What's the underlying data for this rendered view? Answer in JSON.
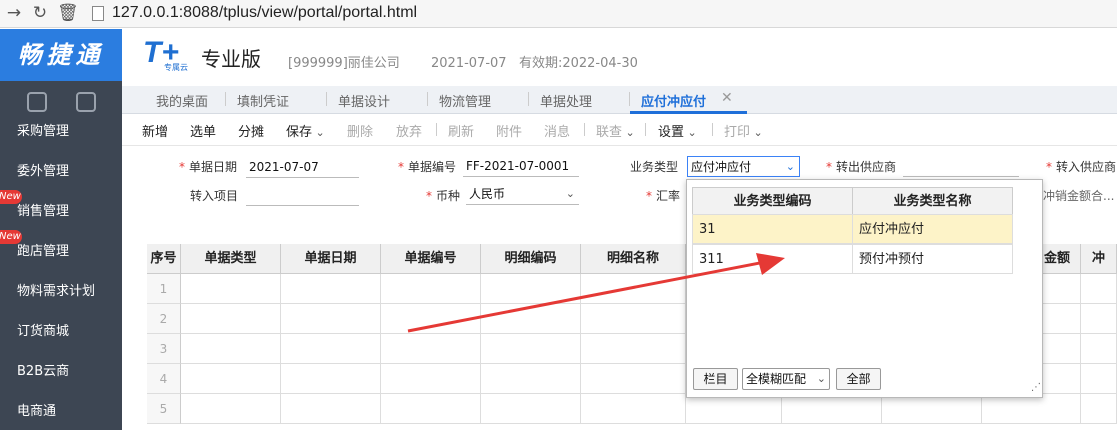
{
  "browser": {
    "url": "127.0.0.1:8088/tplus/view/portal/portal.html"
  },
  "sidebar": {
    "brand": "畅捷通",
    "items": [
      {
        "label": "采购管理"
      },
      {
        "label": "委外管理"
      },
      {
        "label": "销售管理",
        "badge": "New"
      },
      {
        "label": "跑店管理",
        "badge": "New"
      },
      {
        "label": "物料需求计划"
      },
      {
        "label": "订货商城"
      },
      {
        "label": "B2B云商"
      },
      {
        "label": "电商通"
      }
    ]
  },
  "header": {
    "logo": "T+",
    "logo_sub": "专属云",
    "edition": "专业版",
    "company": "[999999]丽佳公司",
    "date_info": "2021-07-07   有效期:2022-04-30"
  },
  "tabs": [
    "我的桌面",
    "填制凭证",
    "单据设计",
    "物流管理",
    "单据处理",
    "应付冲应付"
  ],
  "toolbar": {
    "items": [
      "新增",
      "选单",
      "分摊",
      "保存",
      "删除",
      "放弃",
      "刷新",
      "附件",
      "消息",
      "联查",
      "设置",
      "打印"
    ]
  },
  "form": {
    "doc_date_label": "单据日期",
    "doc_date": "2021-07-07",
    "doc_no_label": "单据编号",
    "doc_no": "FF-2021-07-0001",
    "biz_type_label": "业务类型",
    "biz_type": "应付冲应付",
    "out_supplier_label": "转出供应商",
    "in_supplier_label": "转入供应商",
    "in_project_label": "转入项目",
    "currency_label": "币种",
    "currency": "人民币",
    "rate_label": "汇率",
    "offset_amount_label": "冲销金额合..."
  },
  "grid": {
    "columns": [
      "序号",
      "单据类型",
      "单据日期",
      "单据编号",
      "明细编码",
      "明细名称",
      "金额",
      "冲"
    ],
    "rows": [
      "1",
      "2",
      "3",
      "4",
      "5"
    ]
  },
  "popup": {
    "headers": [
      "业务类型编码",
      "业务类型名称"
    ],
    "rows": [
      {
        "code": "31",
        "name": "应付冲应付"
      },
      {
        "code": "311",
        "name": "预付冲预付"
      }
    ],
    "btn_columns": "栏目",
    "match_mode": "全模糊匹配",
    "btn_all": "全部"
  },
  "colors": {
    "accent": "#1e6fd9",
    "sidebar": "#3d4653",
    "highlight": "#fdf3c8",
    "arrow": "#e53935"
  }
}
